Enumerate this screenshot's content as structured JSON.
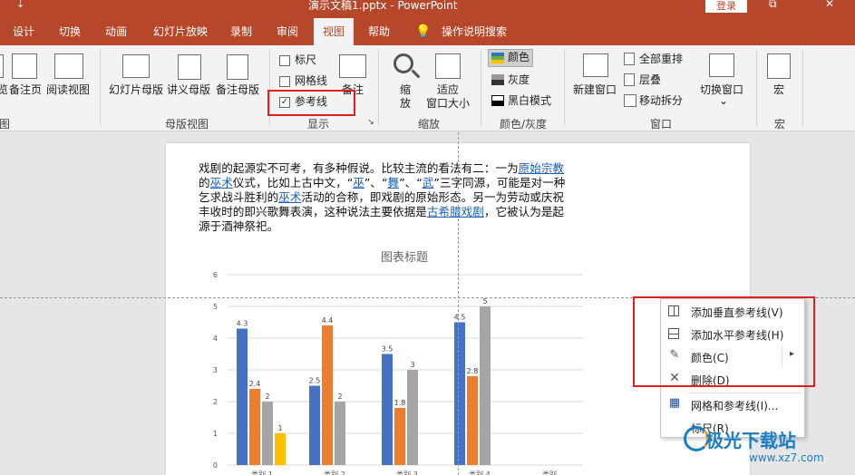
{
  "titlebar": {
    "qat_glyph": "⇣",
    "title": "演示文稿1.pptx  -  PowerPoint",
    "login": "登录",
    "restore_glyph": "⧉",
    "close_glyph": "✕"
  },
  "tabs": [
    "设计",
    "切换",
    "动画",
    "幻灯片放映",
    "录制",
    "审阅",
    "视图",
    "帮助",
    "操作说明搜索"
  ],
  "active_tab": "视图",
  "ribbon": {
    "presentation_views": {
      "partial_label": "览",
      "notes_page": "备注页",
      "reading_view": "阅读视图",
      "group": "图"
    },
    "master_views": {
      "slide_master": "幻灯片母版",
      "handout_master": "讲义母版",
      "notes_master": "备注母版",
      "group": "母版视图"
    },
    "show": {
      "ruler": "标尺",
      "gridlines": "网格线",
      "guides": "参考线",
      "notes": "备注",
      "group": "显示",
      "launcher": "↘"
    },
    "zoom": {
      "zoom": "缩\n放",
      "fit": "适应\n窗口大小",
      "group": "缩放"
    },
    "color": {
      "color": "颜色",
      "grayscale": "灰度",
      "bw": "黑白模式",
      "group": "颜色/灰度"
    },
    "window": {
      "new_window": "新建窗口",
      "arrange_all": "全部重排",
      "cascade": "层叠",
      "move_split": "移动拆分",
      "switch": "切换窗口",
      "switch_caret": "⌄",
      "group": "窗口"
    },
    "macro": {
      "macro": "宏",
      "group": "宏"
    }
  },
  "slide": {
    "para": {
      "t1": "戏剧的起源实不可考，有多种假说。比较主流的看法有二：一为",
      "l1": "原始宗教",
      "t2": "的",
      "l2": "巫术",
      "t3": "仪式，比如上古中文，“",
      "l3": "巫",
      "t4": "”、“",
      "l4": "舞",
      "t5": "”、“",
      "l5": "武",
      "t6": "”三字同源，可能是对一种乞求战斗胜利的",
      "l6": "巫术",
      "t7": "活动的合称，即戏剧的原始形态。另一为劳动或庆祝丰收时的即兴歌舞表演，这种说法主要依据是",
      "l7": "古希腊戏剧",
      "t8": "，它被认为是起源于酒神祭祀。"
    }
  },
  "chart_data": {
    "type": "bar",
    "title": "图表标题",
    "categories": [
      "类别 1",
      "类别 2",
      "类别 3",
      "类别 4"
    ],
    "series": [
      {
        "values": [
          4.3,
          2.5,
          3.5,
          4.5
        ],
        "color": "#4472c4"
      },
      {
        "values": [
          2.4,
          4.4,
          1.8,
          2.8
        ],
        "color": "#ed7d31"
      },
      {
        "values": [
          2,
          2,
          3,
          5
        ],
        "color": "#a5a5a5"
      },
      {
        "values": [
          1,
          null,
          null,
          null
        ],
        "color": "#ffc000"
      }
    ],
    "ylim": [
      0,
      6
    ],
    "yticks": [
      0,
      1,
      2,
      3,
      4,
      5,
      6
    ],
    "grid": true,
    "extra_category_label": "类别"
  },
  "context_menu": {
    "items": [
      {
        "label": "添加垂直参考线(V)",
        "icon": "vertical-guide-icon"
      },
      {
        "label": "添加水平参考线(H)",
        "icon": "horizontal-guide-icon"
      },
      {
        "label": "颜色(C)",
        "icon": "pen-color-icon"
      },
      {
        "label": "删除(D)",
        "icon": "delete-icon"
      },
      {
        "label": "网格和参考线(I)...",
        "icon": "grid-icon"
      },
      {
        "label": "标尺(R)",
        "icon": ""
      }
    ],
    "submenu_arrow": "▸"
  },
  "watermark": {
    "text": "极光下载站",
    "url": "www.xz7.com"
  },
  "colors": {
    "accent": "#b7472a",
    "highlight": "#e02020",
    "link": "#1a5fb4"
  }
}
